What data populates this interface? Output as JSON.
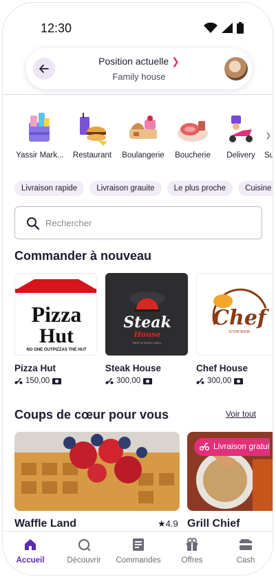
{
  "status_bar": {
    "time": "12:30"
  },
  "header": {
    "title": "Position actuelle",
    "subtitle": "Family house"
  },
  "categories": [
    {
      "label": "Yassir Mark...",
      "icon": "grocery-bag-icon"
    },
    {
      "label": "Restaurant",
      "icon": "fast-food-icon"
    },
    {
      "label": "Boulangerie",
      "icon": "bakery-icon"
    },
    {
      "label": "Boucherie",
      "icon": "meat-icon"
    },
    {
      "label": "Delivery",
      "icon": "delivery-scooter-icon"
    },
    {
      "label": "Sup",
      "icon": "supermarket-icon"
    }
  ],
  "chips": [
    "Livraison rapide",
    "Livraison grauite",
    "Le plus proche",
    "Cuisine"
  ],
  "search": {
    "placeholder": "Rechercher"
  },
  "reorder": {
    "title": "Commander à nouveau",
    "items": [
      {
        "name": "Pizza Hut",
        "price": "150,00",
        "logo_text_1": "Pizza",
        "logo_text_2": "Hut",
        "tagline": "NO ONE OUTPIZZAS THE HUT"
      },
      {
        "name": "Steak House",
        "price": "300,00",
        "logo_text_1": "Steak",
        "logo_text_2": "House",
        "tagline": "BEEF & SHACK GRILL"
      },
      {
        "name": "Chef House",
        "price": "300,00",
        "logo_text_1": "Chef",
        "tagline": "ICTOR BOOK"
      }
    ]
  },
  "favorites": {
    "title": "Coups de cœur pour vous",
    "see_all": "Voir tout",
    "items": [
      {
        "name": "Waffle Land",
        "rating": "4.9"
      },
      {
        "name": "Grill Chief",
        "promo": "Livraison gratuite"
      }
    ]
  },
  "bottom_nav": [
    {
      "label": "Accueil",
      "icon": "home-icon",
      "active": true
    },
    {
      "label": "Découvrir",
      "icon": "discover-icon"
    },
    {
      "label": "Commandes",
      "icon": "orders-icon"
    },
    {
      "label": "Offres",
      "icon": "gift-icon"
    },
    {
      "label": "Cash",
      "icon": "wallet-icon"
    }
  ],
  "colors": {
    "accent": "#5b2bb5",
    "promo": "#e0307a",
    "chip_bg": "#f1ecf5"
  }
}
